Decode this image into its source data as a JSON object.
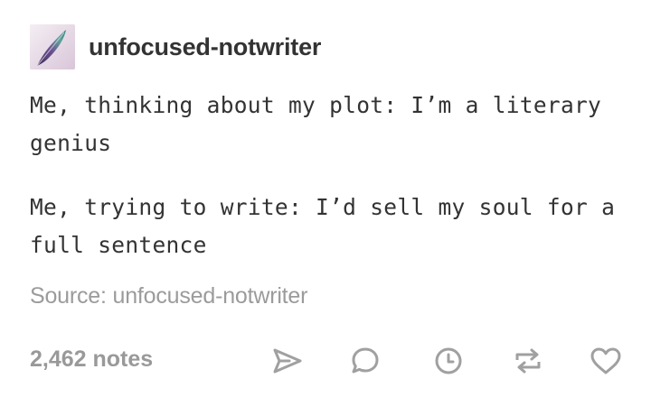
{
  "post": {
    "username": "unfocused-notwriter",
    "body": [
      "Me, thinking about my plot: I’m a literary genius",
      "Me, trying to write: I’d sell my soul for a full sentence"
    ],
    "source_label": "Source: unfocused-notwriter",
    "notes": "2,462 notes"
  },
  "actions": [
    {
      "name": "share",
      "icon": "paper-plane-icon"
    },
    {
      "name": "reply",
      "icon": "speech-bubble-icon"
    },
    {
      "name": "queue",
      "icon": "clock-icon"
    },
    {
      "name": "reblog",
      "icon": "reblog-icon"
    },
    {
      "name": "like",
      "icon": "heart-icon"
    }
  ],
  "colors": {
    "text": "#333333",
    "muted": "#9b9b9b",
    "icon": "#a0a0a0",
    "background": "#ffffff"
  }
}
